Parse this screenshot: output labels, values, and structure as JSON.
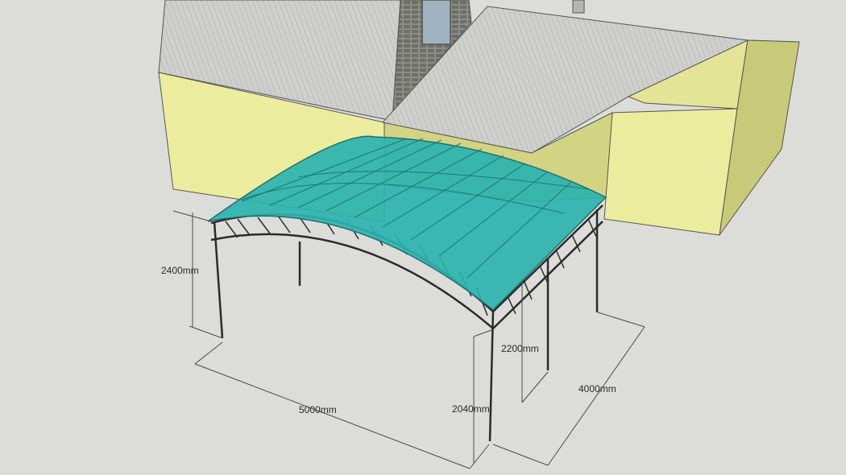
{
  "dimensions": {
    "height_left": "2400mm",
    "height_mid": "2200mm",
    "height_front": "2040mm",
    "width": "5000mm",
    "depth": "4000mm"
  },
  "colors": {
    "background": "#dcdcd8",
    "wall": "#ecec9e",
    "wall_shadow": "#cfcf82",
    "roof": "#c9c9c7",
    "roof_lines": "#9a9a98",
    "brick": "#8a8a86",
    "canopy": "#2bb3b0",
    "canopy_dark": "#1f8f8c",
    "frame": "#2b2b2b",
    "dim_lines": "#4a4a4a"
  }
}
